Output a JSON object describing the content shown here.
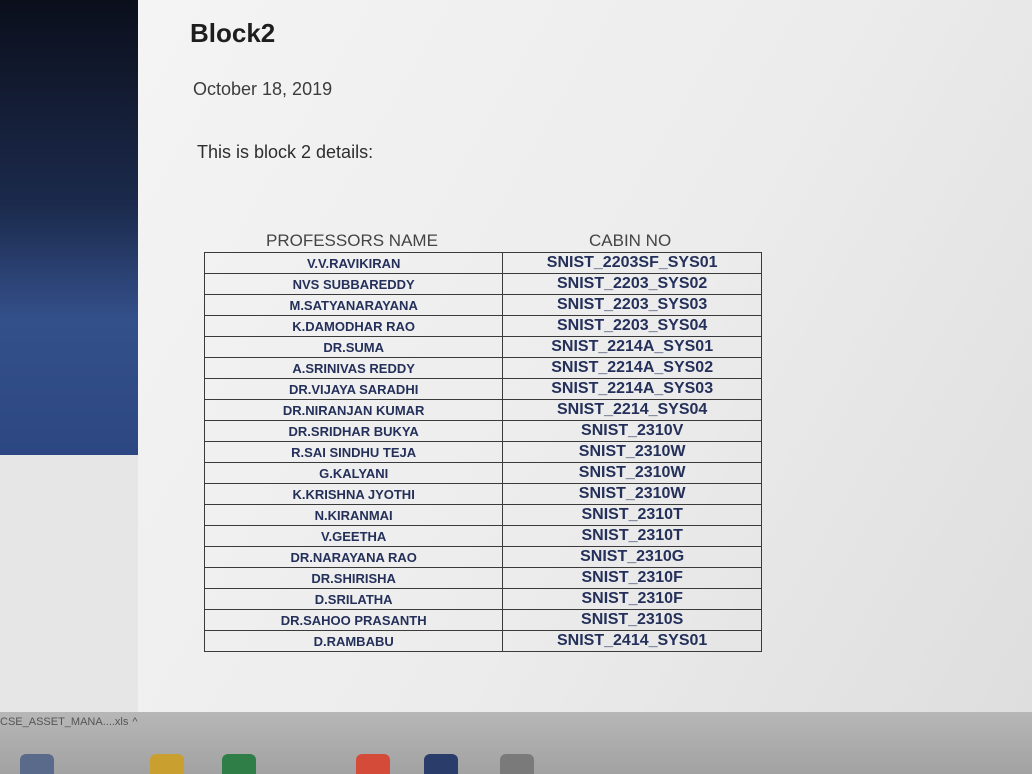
{
  "post": {
    "title": "Block2",
    "date": "October 18, 2019",
    "body": "This is block 2 details:"
  },
  "table": {
    "headers": [
      "PROFESSORS NAME",
      "CABIN NO"
    ],
    "rows": [
      [
        "V.V.RAVIKIRAN",
        "SNIST_2203SF_SYS01"
      ],
      [
        "NVS SUBBAREDDY",
        "SNIST_2203_SYS02"
      ],
      [
        "M.SATYANARAYANA",
        "SNIST_2203_SYS03"
      ],
      [
        "K.DAMODHAR RAO",
        "SNIST_2203_SYS04"
      ],
      [
        "DR.SUMA",
        "SNIST_2214A_SYS01"
      ],
      [
        "A.SRINIVAS REDDY",
        "SNIST_2214A_SYS02"
      ],
      [
        "DR.VIJAYA SARADHI",
        "SNIST_2214A_SYS03"
      ],
      [
        "DR.NIRANJAN KUMAR",
        "SNIST_2214_SYS04"
      ],
      [
        "DR.SRIDHAR BUKYA",
        "SNIST_2310V"
      ],
      [
        "R.SAI SINDHU TEJA",
        "SNIST_2310W"
      ],
      [
        "G.KALYANI",
        "SNIST_2310W"
      ],
      [
        "K.KRISHNA JYOTHI",
        "SNIST_2310W"
      ],
      [
        "N.KIRANMAI",
        "SNIST_2310T"
      ],
      [
        "V.GEETHA",
        "SNIST_2310T"
      ],
      [
        "DR.NARAYANA RAO",
        "SNIST_2310G"
      ],
      [
        "DR.SHIRISHA",
        "SNIST_2310F"
      ],
      [
        "D.SRILATHA",
        "SNIST_2310F"
      ],
      [
        "DR.SAHOO PRASANTH",
        "SNIST_2310S"
      ],
      [
        "D.RAMBABU",
        "SNIST_2414_SYS01"
      ]
    ]
  },
  "download_bar": {
    "file_label": "CSE_ASSET_MANA....xls"
  },
  "taskbar": {
    "icons": [
      {
        "name": "start-icon",
        "color": "#5a6a8a"
      },
      {
        "name": "file-explorer-icon",
        "color": "#c9a030"
      },
      {
        "name": "excel-icon",
        "color": "#2f7d47"
      },
      {
        "name": "chrome-icon",
        "color": "#d44b3a"
      },
      {
        "name": "app-icon",
        "color": "#2a3c6a"
      },
      {
        "name": "app-icon-2",
        "color": "#7a7a7a"
      }
    ]
  }
}
